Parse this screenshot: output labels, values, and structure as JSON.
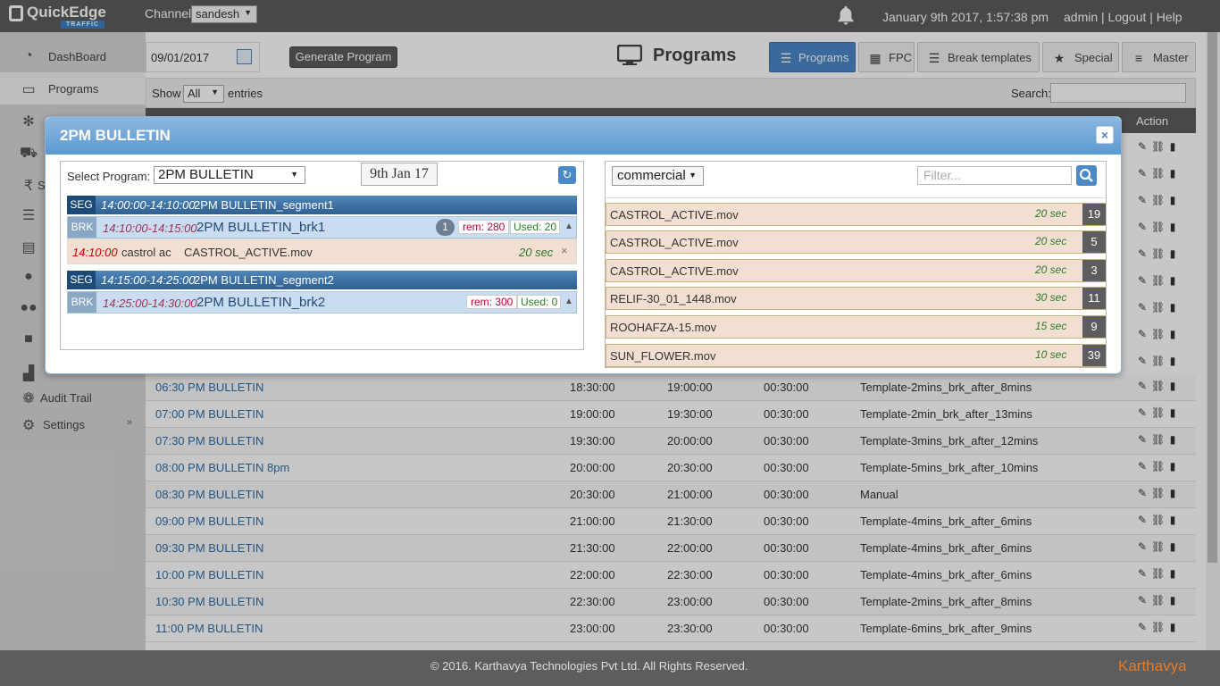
{
  "brand": {
    "name": "QuickEdge",
    "sub": "TRAFFIC",
    "colors": {
      "accent": "#4a88c7",
      "topbar": "#5d5d5d"
    }
  },
  "header": {
    "channel_label": "Channel",
    "channel_value": "sandesh",
    "datetime": "January 9th 2017, 1:57:38 pm",
    "user_links": "admin | Logout | Help",
    "bell_icon": "bell-icon"
  },
  "sidebar": {
    "items": [
      {
        "label": "DashBoard",
        "icon": "dashboard-icon"
      },
      {
        "label": "Programs",
        "icon": "monitor-icon"
      },
      {
        "label": "",
        "icon": "yelp-icon"
      },
      {
        "label": "",
        "icon": "cart-icon"
      },
      {
        "label": "S",
        "icon": "rupee-icon"
      },
      {
        "label": "",
        "icon": "list-icon"
      },
      {
        "label": "",
        "icon": "document-icon"
      },
      {
        "label": "",
        "icon": "user-icon"
      },
      {
        "label": "",
        "icon": "users-icon"
      },
      {
        "label": "",
        "icon": "video-icon"
      },
      {
        "label": "",
        "icon": "bar-chart-icon"
      },
      {
        "label": "Audit Trail",
        "icon": "paw-icon"
      },
      {
        "label": "Settings",
        "icon": "gear-icon"
      }
    ]
  },
  "toolbar": {
    "date_value": "09/01/2017",
    "generate_label": "Generate Program",
    "page_title": "Programs",
    "tabs": [
      {
        "label": "Programs",
        "icon": "list-icon"
      },
      {
        "label": "FPC",
        "icon": "calendar-icon"
      },
      {
        "label": "Break templates",
        "icon": "list-icon"
      },
      {
        "label": "Special",
        "icon": "star-icon"
      },
      {
        "label": "Master",
        "icon": "menu-icon"
      }
    ]
  },
  "list_controls": {
    "show_label": "Show",
    "show_value": "All",
    "entries_label": "entries",
    "search_label": "Search:"
  },
  "table": {
    "action_header": "Action",
    "rows": [
      {
        "name": "06:30 PM BULLETIN",
        "start": "18:30:00",
        "end": "19:00:00",
        "duration": "00:30:00",
        "template": "Template-2mins_brk_after_8mins"
      },
      {
        "name": "07:00 PM BULLETIN",
        "start": "19:00:00",
        "end": "19:30:00",
        "duration": "00:30:00",
        "template": "Template-2min_brk_after_13mins"
      },
      {
        "name": "07:30 PM BULLETIN",
        "start": "19:30:00",
        "end": "20:00:00",
        "duration": "00:30:00",
        "template": "Template-3mins_brk_after_12mins"
      },
      {
        "name": "08:00 PM BULLETIN 8pm",
        "start": "20:00:00",
        "end": "20:30:00",
        "duration": "00:30:00",
        "template": "Template-5mins_brk_after_10mins"
      },
      {
        "name": "08:30 PM BULLETIN",
        "start": "20:30:00",
        "end": "21:00:00",
        "duration": "00:30:00",
        "template": "Manual"
      },
      {
        "name": "09:00 PM BULLETIN",
        "start": "21:00:00",
        "end": "21:30:00",
        "duration": "00:30:00",
        "template": "Template-4mins_brk_after_6mins"
      },
      {
        "name": "09:30 PM BULLETIN",
        "start": "21:30:00",
        "end": "22:00:00",
        "duration": "00:30:00",
        "template": "Template-4mins_brk_after_6mins"
      },
      {
        "name": "10:00 PM BULLETIN",
        "start": "22:00:00",
        "end": "22:30:00",
        "duration": "00:30:00",
        "template": "Template-4mins_brk_after_6mins"
      },
      {
        "name": "10:30 PM BULLETIN",
        "start": "22:30:00",
        "end": "23:00:00",
        "duration": "00:30:00",
        "template": "Template-2mins_brk_after_8mins"
      },
      {
        "name": "11:00 PM BULLETIN",
        "start": "23:00:00",
        "end": "23:30:00",
        "duration": "00:30:00",
        "template": "Template-6mins_brk_after_9mins"
      }
    ]
  },
  "modal": {
    "title": "2PM BULLETIN",
    "close": "×",
    "select_label": "Select Program:",
    "program_value": "2PM BULLETIN",
    "date_chip": "9th Jan 17",
    "refresh_icon": "refresh-icon",
    "segments": [
      {
        "tag": "SEG",
        "time": "14:00:00-14:10:00",
        "name": "2PM BULLETIN_segment1"
      },
      {
        "tag": "SEG",
        "time": "14:15:00-14:25:00",
        "name": "2PM BULLETIN_segment2"
      }
    ],
    "breaks": [
      {
        "tag": "BRK",
        "time": "14:10:00-14:15:00",
        "name": "2PM BULLETIN_brk1",
        "count": "1",
        "rem": "rem: 280",
        "used": "Used: 20"
      },
      {
        "tag": "BRK",
        "time": "14:25:00-14:30:00",
        "name": "2PM BULLETIN_brk2",
        "rem": "rem: 300",
        "used": "Used: 0"
      }
    ],
    "spot": {
      "time": "14:10:00",
      "name": "castrol ac",
      "file": "CASTROL_ACTIVE.mov",
      "duration": "20 sec",
      "remove": "×"
    },
    "type_value": "commercial",
    "filter_placeholder": "Filter...",
    "media": [
      {
        "name": "CASTROL_ACTIVE.mov",
        "duration": "20 sec",
        "count": "19"
      },
      {
        "name": "CASTROL_ACTIVE.mov",
        "duration": "20 sec",
        "count": "5"
      },
      {
        "name": "CASTROL_ACTIVE.mov",
        "duration": "20 sec",
        "count": "3"
      },
      {
        "name": "RELIF-30_01_1448.mov",
        "duration": "30 sec",
        "count": "11"
      },
      {
        "name": "ROOHAFZA-15.mov",
        "duration": "15 sec",
        "count": "9"
      },
      {
        "name": "SUN_FLOWER.mov",
        "duration": "10 sec",
        "count": "39"
      }
    ]
  },
  "footer": {
    "copyright": "© 2016. Karthavya Technologies Pvt Ltd. All Rights Reserved.",
    "brand": "Karthavya"
  }
}
